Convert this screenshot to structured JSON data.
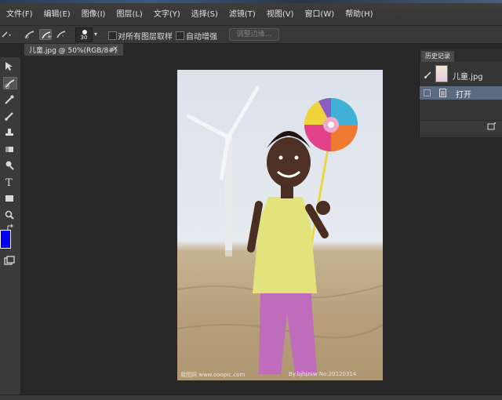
{
  "menu": [
    "文件(F)",
    "编辑(E)",
    "图像(I)",
    "图层(L)",
    "文字(Y)",
    "选择(S)",
    "滤镜(T)",
    "视图(V)",
    "窗口(W)",
    "帮助(H)"
  ],
  "options": {
    "brush_size": "30",
    "sample_all_layers": "对所有图层取样",
    "auto_enhance": "自动增强",
    "refine_edge": "调整边缘..."
  },
  "document_tab": {
    "title": "儿童.jpg @ 50%(RGB/8#)",
    "close": "×"
  },
  "history": {
    "tab": "历史记录",
    "snapshot": "儿童.jpg",
    "state": "打开"
  },
  "photo_watermark": {
    "left": "我图网 www.ooopic.com",
    "right": "By:bjhjzsw No:20120314"
  },
  "colors": {
    "foreground": "#0000ee",
    "background": "#ffffff"
  }
}
